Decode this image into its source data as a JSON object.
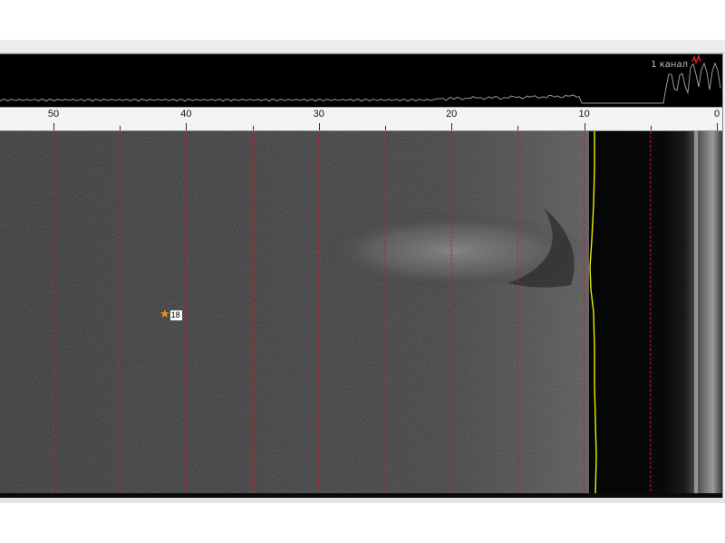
{
  "channel": {
    "label": "1 канал"
  },
  "range_ruler": {
    "ticks": [
      50,
      40,
      30,
      20,
      10,
      0
    ],
    "minor_ticks": [
      45,
      35,
      25,
      15,
      5
    ]
  },
  "marker": {
    "label": "18",
    "icon": "star-icon"
  },
  "colors": {
    "range_line": "#c0202a",
    "bottom_trace": "#e8f000",
    "amplitude_trace": "#9a9a9a",
    "peak_marker": "#e02020",
    "marker_star": "#e89420"
  }
}
